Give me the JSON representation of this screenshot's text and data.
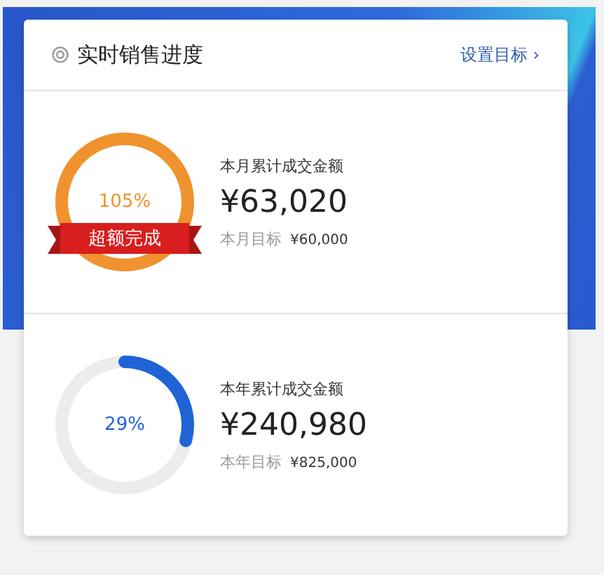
{
  "card": {
    "title": "实时销售进度",
    "link": "设置目标 ›"
  },
  "goals": [
    {
      "label": "本月累计成交金额",
      "amount": "¥63,020",
      "target_label": "本月目标",
      "target_value": "¥60,000",
      "percent": "105%",
      "color": "#f0922e",
      "badge": "超额完成"
    },
    {
      "label": "本年累计成交金额",
      "amount": "¥240,980",
      "target_label": "本年目标",
      "target_value": "¥825,000",
      "percent": "29%",
      "level": 0.29,
      "color": "#1f63d6"
    }
  ]
}
